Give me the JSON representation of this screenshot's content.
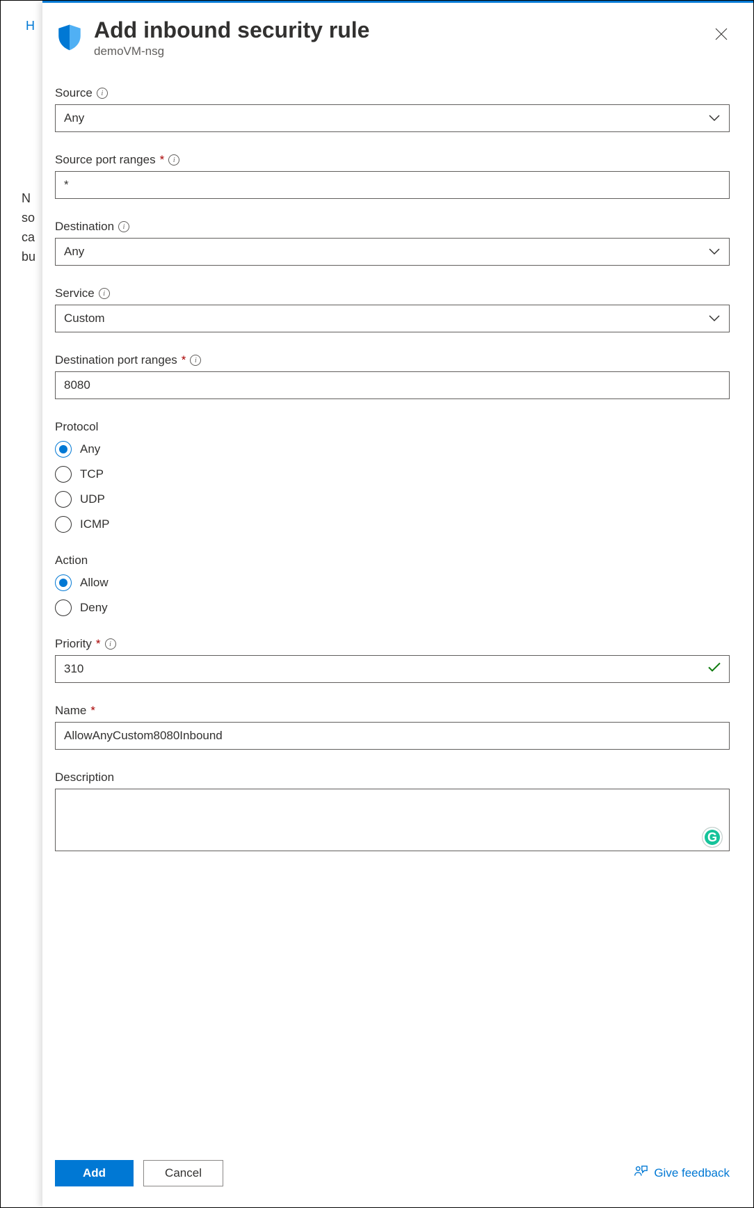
{
  "bg": {
    "link": "H",
    "text": "N\nso\nca\nbu"
  },
  "panel": {
    "title": "Add inbound security rule",
    "subtitle": "demoVM-nsg"
  },
  "form": {
    "source": {
      "label": "Source",
      "value": "Any"
    },
    "sourcePort": {
      "label": "Source port ranges",
      "value": "*"
    },
    "destination": {
      "label": "Destination",
      "value": "Any"
    },
    "service": {
      "label": "Service",
      "value": "Custom"
    },
    "destPort": {
      "label": "Destination port ranges",
      "value": "8080"
    },
    "protocol": {
      "label": "Protocol",
      "options": [
        "Any",
        "TCP",
        "UDP",
        "ICMP"
      ],
      "selected": "Any"
    },
    "action": {
      "label": "Action",
      "options": [
        "Allow",
        "Deny"
      ],
      "selected": "Allow"
    },
    "priority": {
      "label": "Priority",
      "value": "310"
    },
    "name": {
      "label": "Name",
      "value": "AllowAnyCustom8080Inbound"
    },
    "description": {
      "label": "Description",
      "value": ""
    }
  },
  "footer": {
    "add": "Add",
    "cancel": "Cancel",
    "feedback": "Give feedback"
  }
}
